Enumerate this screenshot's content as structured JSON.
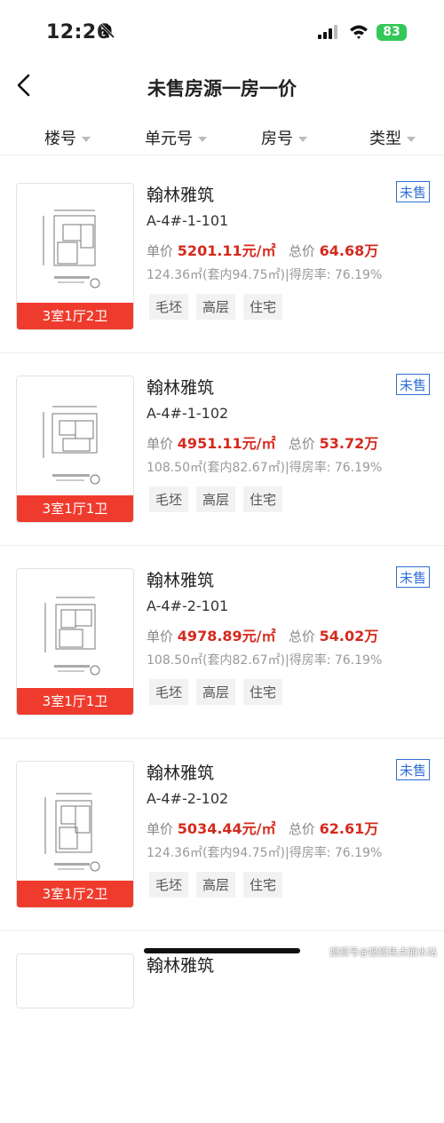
{
  "status_bar": {
    "time": "12:26",
    "battery": "83"
  },
  "header": {
    "title": "未售房源一房一价"
  },
  "filters": [
    {
      "label": "楼号"
    },
    {
      "label": "单元号"
    },
    {
      "label": "房号"
    },
    {
      "label": "类型"
    }
  ],
  "labels": {
    "unit_price": "单价",
    "total_price": "总价"
  },
  "listings": [
    {
      "name": "翰林雅筑",
      "status": "未售",
      "code": "A-4#-1-101",
      "unit_price": "5201.11元/㎡",
      "total_price": "64.68万",
      "area": "124.36㎡(套内94.75㎡)|得房率: 76.19%",
      "layout": "3室1厅2卫",
      "tags": [
        "毛坯",
        "高层",
        "住宅"
      ]
    },
    {
      "name": "翰林雅筑",
      "status": "未售",
      "code": "A-4#-1-102",
      "unit_price": "4951.11元/㎡",
      "total_price": "53.72万",
      "area": "108.50㎡(套内82.67㎡)|得房率: 76.19%",
      "layout": "3室1厅1卫",
      "tags": [
        "毛坯",
        "高层",
        "住宅"
      ]
    },
    {
      "name": "翰林雅筑",
      "status": "未售",
      "code": "A-4#-2-101",
      "unit_price": "4978.89元/㎡",
      "total_price": "54.02万",
      "area": "108.50㎡(套内82.67㎡)|得房率: 76.19%",
      "layout": "3室1厅1卫",
      "tags": [
        "毛坯",
        "高层",
        "住宅"
      ]
    },
    {
      "name": "翰林雅筑",
      "status": "未售",
      "code": "A-4#-2-102",
      "unit_price": "5034.44元/㎡",
      "total_price": "62.61万",
      "area": "124.36㎡(套内94.75㎡)|得房率: 76.19%",
      "layout": "3室1厅2卫",
      "tags": [
        "毛坯",
        "高层",
        "住宅"
      ]
    },
    {
      "name": "翰林雅筑"
    }
  ],
  "watermark": "搜狐号@搜狐焦点丽水站"
}
